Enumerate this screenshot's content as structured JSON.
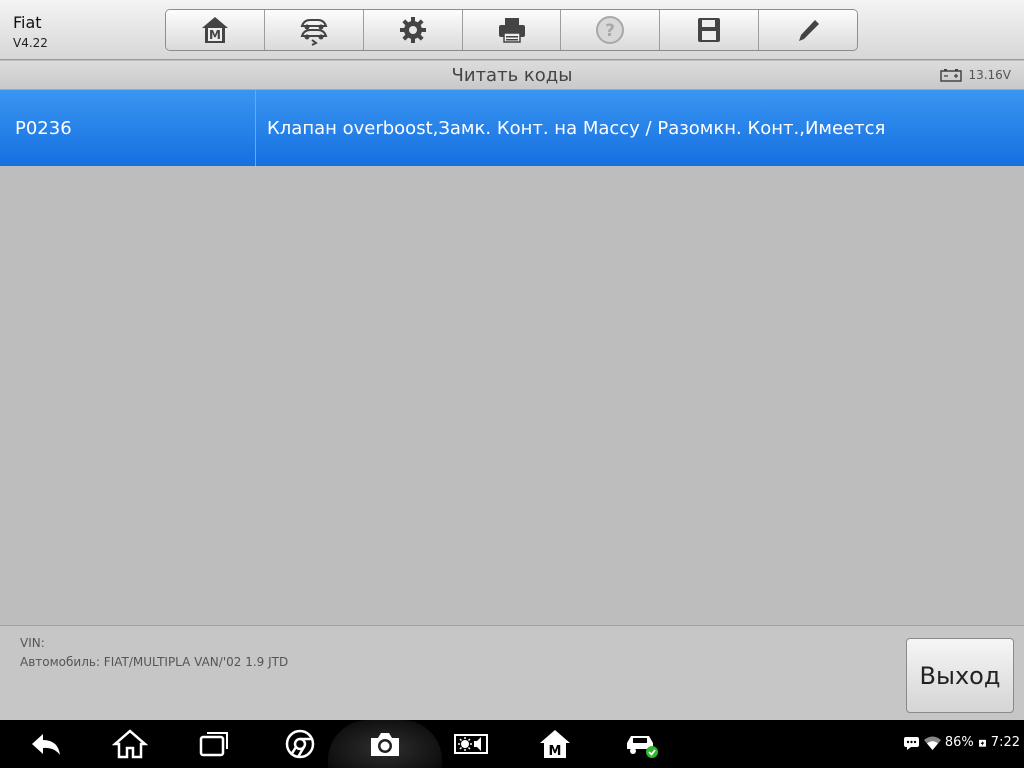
{
  "app": {
    "name": "Fiat",
    "version": "V4.22"
  },
  "toolbar": {
    "buttons": [
      {
        "icon": "home-m-icon"
      },
      {
        "icon": "vehicle-swap-icon"
      },
      {
        "icon": "gear-icon"
      },
      {
        "icon": "printer-icon"
      },
      {
        "icon": "help-icon"
      },
      {
        "icon": "save-icon"
      },
      {
        "icon": "pencil-icon"
      }
    ]
  },
  "screen": {
    "title": "Читать коды",
    "voltage": "13.16V"
  },
  "dtc": {
    "rows": [
      {
        "code": "P0236",
        "description": "Клапан overboost,Замк. Конт. на Массу / Разомкн. Конт.,Имеется"
      }
    ]
  },
  "info": {
    "vin_label": "VIN:",
    "vehicle": "Автомобиль: FIAT/MULTIPLA VAN/'02 1.9 JTD"
  },
  "exit_label": "Выход",
  "status": {
    "battery": "86%",
    "time": "7:22"
  },
  "colors": {
    "selected_row": "#1e7be6",
    "background": "#bdbdbd"
  }
}
